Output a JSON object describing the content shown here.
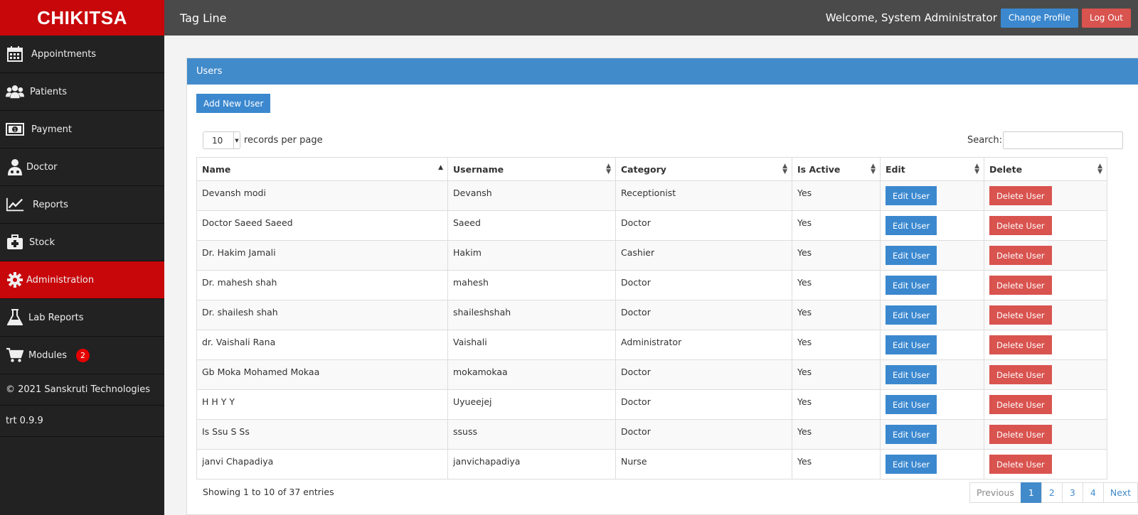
{
  "brand": "CHIKITSA",
  "sidebar": {
    "items": [
      {
        "label": "Appointments",
        "icon": "calendar-icon"
      },
      {
        "label": "Patients",
        "icon": "users-icon"
      },
      {
        "label": "Payment",
        "icon": "money-icon"
      },
      {
        "label": "Doctor",
        "icon": "doctor-icon"
      },
      {
        "label": "Reports",
        "icon": "chart-line-icon"
      },
      {
        "label": "Stock",
        "icon": "medkit-icon"
      },
      {
        "label": "Administration",
        "icon": "gear-icon",
        "active": true
      },
      {
        "label": "Lab Reports",
        "icon": "flask-icon"
      },
      {
        "label": "Modules",
        "icon": "cart-icon",
        "badge": "2"
      }
    ],
    "copyright": "© 2021 Sanskruti Technologies",
    "version": "trt 0.9.9"
  },
  "topbar": {
    "tagline": "Tag Line",
    "welcome": "Welcome, System Administrator",
    "change_profile": "Change Profile",
    "logout": "Log Out"
  },
  "panel": {
    "title": "Users",
    "add_button": "Add New User",
    "length_value": "10",
    "length_label": "records per page",
    "search_label": "Search:"
  },
  "table": {
    "columns": [
      "Name",
      "Username",
      "Category",
      "Is Active",
      "Edit",
      "Delete"
    ],
    "edit_label": "Edit User",
    "delete_label": "Delete User",
    "rows": [
      [
        "Devansh modi",
        "Devansh",
        "Receptionist",
        "Yes"
      ],
      [
        "Doctor Saeed Saeed",
        "Saeed",
        "Doctor",
        "Yes"
      ],
      [
        "Dr. Hakim Jamali",
        "Hakim",
        "Cashier",
        "Yes"
      ],
      [
        "Dr. mahesh shah",
        "mahesh",
        "Doctor",
        "Yes"
      ],
      [
        "Dr. shailesh shah",
        "shaileshshah",
        "Doctor",
        "Yes"
      ],
      [
        "dr. Vaishali Rana",
        "Vaishali",
        "Administrator",
        "Yes"
      ],
      [
        "Gb Moka Mohamed Mokaa",
        "mokamokaa",
        "Doctor",
        "Yes"
      ],
      [
        "H H Y Y",
        "Uyueejej",
        "Doctor",
        "Yes"
      ],
      [
        "Is Ssu S Ss",
        "ssuss",
        "Doctor",
        "Yes"
      ],
      [
        "janvi Chapadiya",
        "janvichapadiya",
        "Nurse",
        "Yes"
      ]
    ]
  },
  "footer": {
    "info": "Showing 1 to 10 of 37 entries",
    "previous": "Previous",
    "pages": [
      "1",
      "2",
      "3",
      "4"
    ],
    "next": "Next"
  },
  "colors": {
    "brand_red": "#c8070b",
    "primary_blue": "#428bca",
    "danger_red": "#d9534f",
    "sidebar_bg": "#222222",
    "topbar_bg": "#4a4a4a"
  }
}
